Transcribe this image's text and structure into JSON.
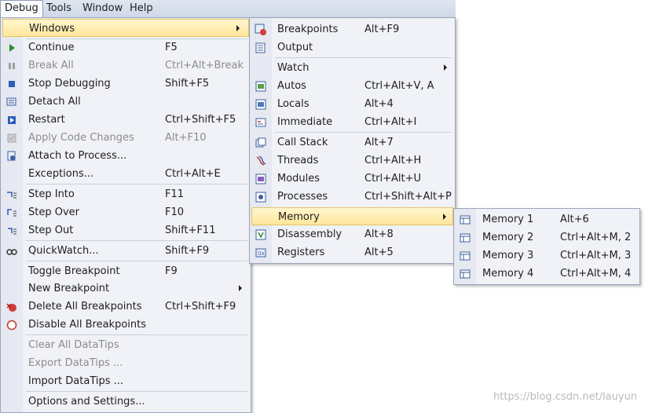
{
  "menubar": {
    "items": [
      "Debug",
      "Tools",
      "Window",
      "Help"
    ]
  },
  "debug_menu": {
    "items": [
      {
        "label": "Windows",
        "shortcut": "",
        "submenu": true
      },
      {
        "label": "Continue",
        "shortcut": "F5",
        "icon": "continue-icon"
      },
      {
        "label": "Break All",
        "shortcut": "Ctrl+Alt+Break",
        "disabled": true,
        "icon": "break-all-icon"
      },
      {
        "label": "Stop Debugging",
        "shortcut": "Shift+F5",
        "icon": "stop-icon"
      },
      {
        "label": "Detach All",
        "shortcut": "",
        "icon": "detach-icon"
      },
      {
        "label": "Restart",
        "shortcut": "Ctrl+Shift+F5",
        "icon": "restart-icon"
      },
      {
        "label": "Apply Code Changes",
        "shortcut": "Alt+F10",
        "disabled": true,
        "icon": "apply-changes-icon"
      },
      {
        "label": "Attach to Process...",
        "shortcut": "",
        "icon": "attach-icon"
      },
      {
        "label": "Exceptions...",
        "shortcut": "Ctrl+Alt+E"
      },
      {
        "label": "Step Into",
        "shortcut": "F11",
        "icon": "step-into-icon"
      },
      {
        "label": "Step Over",
        "shortcut": "F10",
        "icon": "step-over-icon"
      },
      {
        "label": "Step Out",
        "shortcut": "Shift+F11",
        "icon": "step-out-icon"
      },
      {
        "label": "QuickWatch...",
        "shortcut": "Shift+F9",
        "icon": "quickwatch-icon"
      },
      {
        "label": "Toggle Breakpoint",
        "shortcut": "F9"
      },
      {
        "label": "New Breakpoint",
        "shortcut": "",
        "submenu": true
      },
      {
        "label": "Delete All Breakpoints",
        "shortcut": "Ctrl+Shift+F9",
        "icon": "delete-breakpoints-icon"
      },
      {
        "label": "Disable All Breakpoints",
        "shortcut": "",
        "icon": "disable-breakpoints-icon"
      },
      {
        "label": "Clear All DataTips",
        "shortcut": "",
        "disabled": true
      },
      {
        "label": "Export DataTips ...",
        "shortcut": "",
        "disabled": true
      },
      {
        "label": "Import DataTips ...",
        "shortcut": ""
      },
      {
        "label": "Options and Settings...",
        "shortcut": ""
      }
    ]
  },
  "windows_menu": {
    "items": [
      {
        "label": "Breakpoints",
        "shortcut": "Alt+F9",
        "icon": "breakpoints-window-icon"
      },
      {
        "label": "Output",
        "shortcut": "",
        "icon": "output-icon"
      },
      {
        "label": "Watch",
        "shortcut": "",
        "submenu": true
      },
      {
        "label": "Autos",
        "shortcut": "Ctrl+Alt+V, A",
        "icon": "autos-icon"
      },
      {
        "label": "Locals",
        "shortcut": "Alt+4",
        "icon": "locals-icon"
      },
      {
        "label": "Immediate",
        "shortcut": "Ctrl+Alt+I",
        "icon": "immediate-icon"
      },
      {
        "label": "Call Stack",
        "shortcut": "Alt+7",
        "icon": "call-stack-icon"
      },
      {
        "label": "Threads",
        "shortcut": "Ctrl+Alt+H",
        "icon": "threads-icon"
      },
      {
        "label": "Modules",
        "shortcut": "Ctrl+Alt+U",
        "icon": "modules-icon"
      },
      {
        "label": "Processes",
        "shortcut": "Ctrl+Shift+Alt+P",
        "icon": "processes-icon"
      },
      {
        "label": "Memory",
        "shortcut": "",
        "submenu": true
      },
      {
        "label": "Disassembly",
        "shortcut": "Alt+8",
        "icon": "disassembly-icon"
      },
      {
        "label": "Registers",
        "shortcut": "Alt+5",
        "icon": "registers-icon"
      }
    ]
  },
  "memory_menu": {
    "items": [
      {
        "label": "Memory 1",
        "shortcut": "Alt+6"
      },
      {
        "label": "Memory 2",
        "shortcut": "Ctrl+Alt+M, 2"
      },
      {
        "label": "Memory 3",
        "shortcut": "Ctrl+Alt+M, 3"
      },
      {
        "label": "Memory 4",
        "shortcut": "Ctrl+Alt+M, 4"
      }
    ]
  },
  "watermark": "https://blog.csdn.net/lauyun",
  "colors": {
    "highlight": "#ffe69a",
    "menu_bg": "#f0f2f7",
    "disabled": "#8c8c8c"
  }
}
